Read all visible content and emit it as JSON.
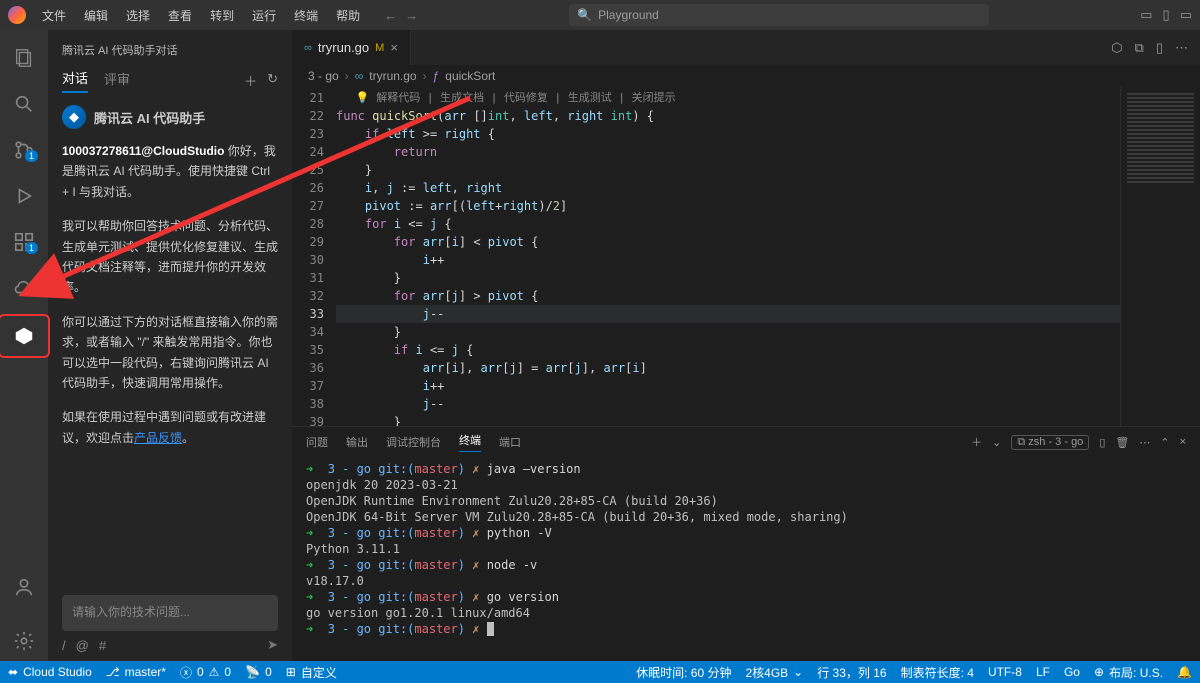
{
  "menubar": {
    "items": [
      "文件",
      "编辑",
      "选择",
      "查看",
      "转到",
      "运行",
      "终端",
      "帮助"
    ],
    "search_placeholder": "Playground"
  },
  "activity": {
    "badge_scm": "1",
    "badge_ext": "1"
  },
  "sidebar": {
    "title": "腾讯云 AI 代码助手对话",
    "tabs": {
      "chat": "对话",
      "review": "评审"
    },
    "assistant_name": "腾讯云 AI 代码助手",
    "para1_strong": "100037278611@CloudStudio",
    "para1_rest": " 你好，我是腾讯云 AI 代码助手。使用快捷键 Ctrl + I 与我对话。",
    "para2": "我可以帮助你回答技术问题、分析代码、生成单元测试、提供优化修复建议、生成代码文档注释等，进而提升你的开发效率。",
    "para3": "你可以通过下方的对话框直接输入你的需求，或者输入 \"/\" 来触发常用指令。你也可以选中一段代码，右键询问腾讯云 AI 代码助手，快速调用常用操作。",
    "para4_a": "如果在使用过程中遇到问题或有改进建议，欢迎点击",
    "para4_link": "产品反馈",
    "para4_b": "。",
    "input_placeholder": "请输入你的技术问题...",
    "toolbar": {
      "slash": "/",
      "at": "@",
      "hash": "#"
    }
  },
  "tab": {
    "filename": "tryrun.go",
    "modified": "M"
  },
  "breadcrumbs": {
    "a": "3 - go",
    "b": "tryrun.go",
    "c": "quickSort"
  },
  "codelens": {
    "items": [
      "解释代码",
      "生成文档",
      "代码修复",
      "生成测试",
      "关闭提示"
    ]
  },
  "code_lines": {
    "start": 21,
    "lines": [
      "",
      "func quickSort(arr []int, left, right int) {",
      "    if left >= right {",
      "        return",
      "    }",
      "    i, j := left, right",
      "    pivot := arr[(left+right)/2]",
      "    for i <= j {",
      "        for arr[i] < pivot {",
      "            i++",
      "        }",
      "        for arr[j] > pivot {",
      "            j--",
      "        }",
      "        if i <= j {",
      "            arr[i], arr[j] = arr[j], arr[i]",
      "            i++",
      "            j--",
      "        }",
      "    }"
    ],
    "current_line": 33
  },
  "panel": {
    "tabs": {
      "problems": "问题",
      "output": "输出",
      "debug": "调试控制台",
      "terminal": "终端",
      "ports": "端口"
    },
    "term_label": "zsh - 3 - go"
  },
  "terminal_lines": [
    {
      "type": "prompt",
      "cmd": "java —version"
    },
    {
      "type": "out",
      "text": "openjdk 20 2023-03-21"
    },
    {
      "type": "out",
      "text": "OpenJDK Runtime Environment Zulu20.28+85-CA (build 20+36)"
    },
    {
      "type": "out",
      "text": "OpenJDK 64-Bit Server VM Zulu20.28+85-CA (build 20+36, mixed mode, sharing)"
    },
    {
      "type": "prompt",
      "cmd": "python -V"
    },
    {
      "type": "out",
      "text": "Python 3.11.1"
    },
    {
      "type": "prompt",
      "cmd": "node -v"
    },
    {
      "type": "out",
      "text": "v18.17.0"
    },
    {
      "type": "prompt",
      "cmd": "go version"
    },
    {
      "type": "out",
      "text": "go version go1.20.1 linux/amd64"
    },
    {
      "type": "prompt",
      "cmd": ""
    }
  ],
  "terminal_prompt": {
    "dir": "3 - go",
    "git": "git:",
    "branch": "master",
    "mark": "✗"
  },
  "statusbar": {
    "remote": "Cloud Studio",
    "branch": "master*",
    "errors": "0",
    "warnings": "0",
    "ports": "0",
    "custom": "自定义",
    "sleep": "休眠时间: 60 分钟",
    "specs": "2核4GB",
    "cursor": "行 33，列 16",
    "spaces": "制表符长度: 4",
    "encoding": "UTF-8",
    "eol": "LF",
    "lang": "Go",
    "layout": "布局: U.S."
  }
}
